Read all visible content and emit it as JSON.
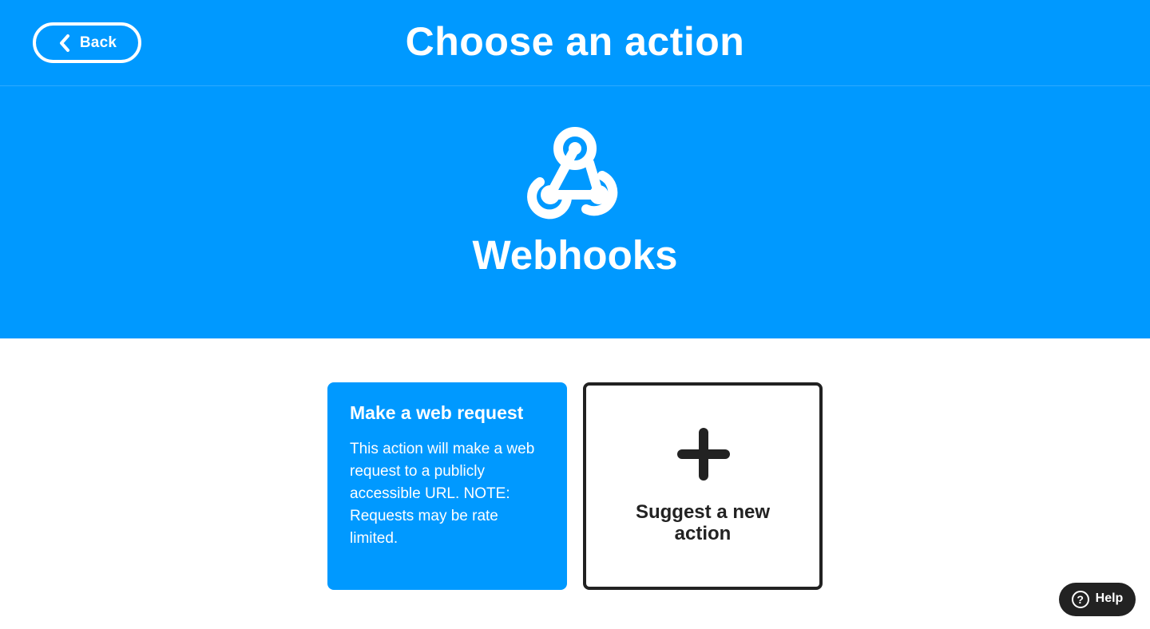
{
  "header": {
    "back_label": "Back",
    "title": "Choose an action"
  },
  "service": {
    "name": "Webhooks",
    "logo_icon": "webhooks-logo-icon"
  },
  "actions": [
    {
      "title": "Make a web request",
      "description": "This action will make a web request to a publicly accessible URL. NOTE: Requests may be rate limited."
    }
  ],
  "suggest": {
    "label": "Suggest a new action",
    "icon": "plus-icon"
  },
  "help": {
    "label": "Help",
    "icon_glyph": "?"
  },
  "colors": {
    "brand_blue": "#0099ff",
    "dark": "#222222",
    "white": "#ffffff"
  }
}
